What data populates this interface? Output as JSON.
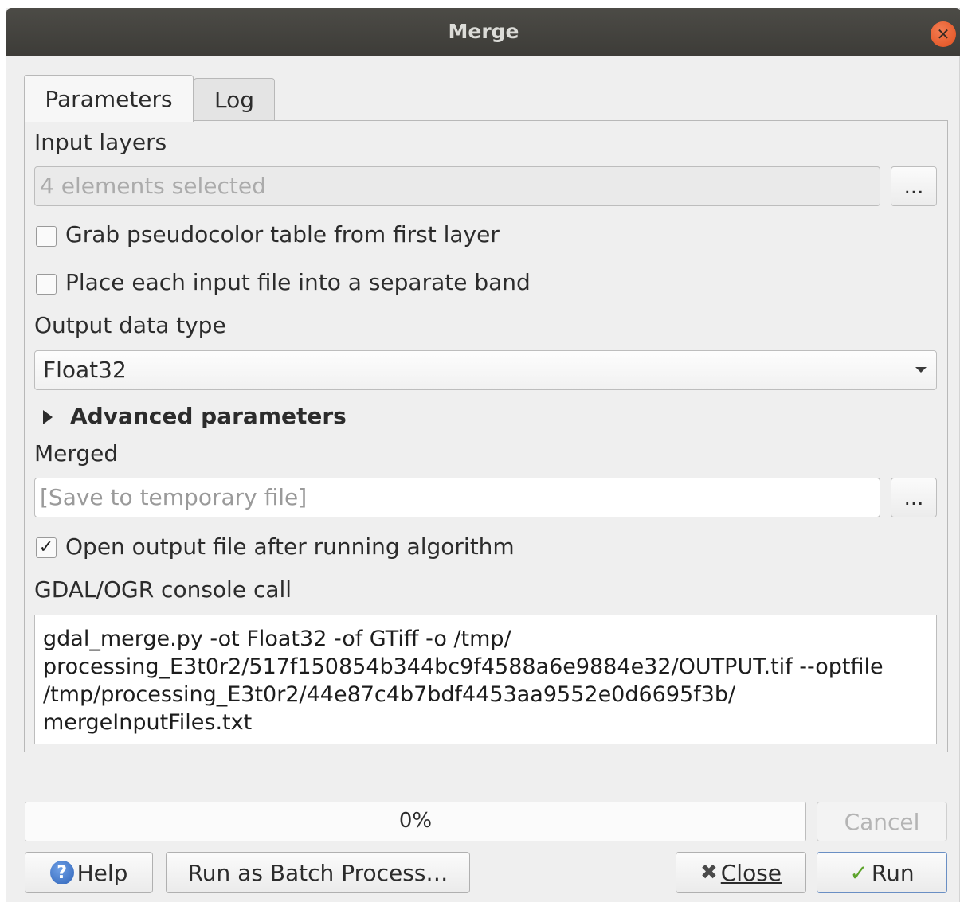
{
  "window": {
    "title": "Merge"
  },
  "tabs": [
    {
      "label": "Parameters",
      "active": true
    },
    {
      "label": "Log",
      "active": false
    }
  ],
  "params": {
    "input_layers": {
      "label": "Input layers",
      "value": "4 elements selected",
      "browse_label": "..."
    },
    "grab_pseudocolor": {
      "label": "Grab pseudocolor table from first layer",
      "checked": false
    },
    "separate_band": {
      "label": "Place each input file into a separate band",
      "checked": false
    },
    "output_data_type": {
      "label": "Output data type",
      "value": "Float32"
    },
    "advanced": {
      "label": "Advanced parameters"
    },
    "merged": {
      "label": "Merged",
      "placeholder": "[Save to temporary file]",
      "browse_label": "..."
    },
    "open_output": {
      "label": "Open output file after running algorithm",
      "checked": true,
      "check_mark": "✓"
    },
    "console": {
      "label": "GDAL/OGR console call",
      "command": "gdal_merge.py -ot Float32 -of GTiff -o /tmp/\nprocessing_E3t0r2/517f150854b344bc9f4588a6e9884e32/OUTPUT.tif --optfile\n/tmp/processing_E3t0r2/44e87c4b7bdf4453aa9552e0d6695f3b/\nmergeInputFiles.txt"
    }
  },
  "footer": {
    "progress_text": "0%",
    "progress_fraction": 0,
    "cancel_label": "Cancel",
    "help_label": "Help",
    "batch_label": "Run as Batch Process…",
    "close_label": "Close",
    "run_label": "Run"
  },
  "icons": {
    "help": "help-icon",
    "close": "close-icon",
    "run": "checkmark-icon",
    "window_close": "window-close-icon"
  },
  "colors": {
    "titlebar": "#3d3c38",
    "window_close": "#e1501e",
    "run_check": "#5da42c",
    "help_icon": "#2e63b8"
  }
}
